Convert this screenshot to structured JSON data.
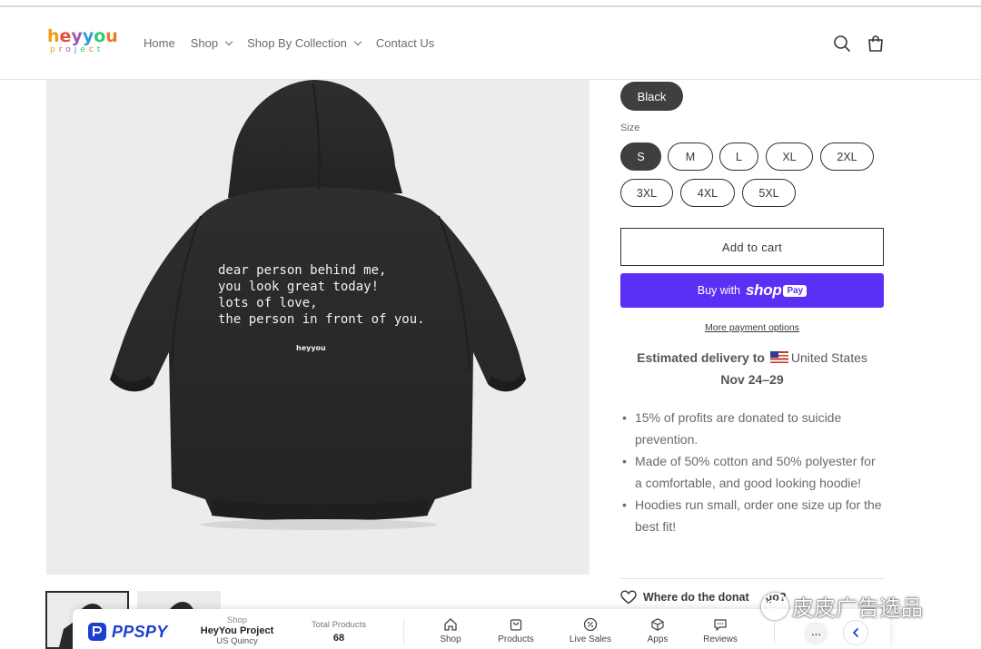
{
  "header": {
    "logo": {
      "word1": "heyyou",
      "word2": "project"
    },
    "nav": [
      {
        "label": "Home",
        "has_dropdown": false
      },
      {
        "label": "Shop",
        "has_dropdown": true
      },
      {
        "label": "Shop By Collection",
        "has_dropdown": true
      },
      {
        "label": "Contact Us",
        "has_dropdown": false
      }
    ],
    "icons": [
      "search-icon",
      "cart-icon"
    ]
  },
  "product_image": {
    "print_text": "dear person behind me,\nyou look great today!\nlots of love,\nthe person in front of you.",
    "print_brand": "heyyou"
  },
  "variant": {
    "color_selected": "Black",
    "size_label": "Size",
    "sizes": [
      "S",
      "M",
      "L",
      "XL",
      "2XL",
      "3XL",
      "4XL",
      "5XL"
    ],
    "size_selected": "S"
  },
  "actions": {
    "add_to_cart": "Add to cart",
    "buy_with": "Buy with",
    "shop_word": "shop",
    "pay_word": "Pay",
    "more_payment": "More payment options"
  },
  "delivery": {
    "label": "Estimated delivery to",
    "country": "United States",
    "dates": "Nov 24–29"
  },
  "bullets": [
    "15% of profits are donated to suicide prevention.",
    "Made of 50% cotton and 50% polyester for a comfortable, and good looking hoodie!",
    "Hoodies run small, order one size up for the best fit!"
  ],
  "donate_question": "Where do the donat",
  "donate_question_tail": "go?",
  "ppspy": {
    "brand": "PPSPY",
    "shop_caption": "Shop",
    "shop_name": "HeyYou Project",
    "shop_location": "US Quincy",
    "total_caption": "Total Products",
    "total_value": "68",
    "tabs": [
      "Shop",
      "Products",
      "Live Sales",
      "Apps",
      "Reviews"
    ],
    "more": "···"
  },
  "watermark": "皮皮广告选品",
  "colors": {
    "accent_shop_pay": "#5a31f4",
    "selected_pill": "#3f3f3f",
    "ppspy_blue": "#1a3fd1"
  }
}
